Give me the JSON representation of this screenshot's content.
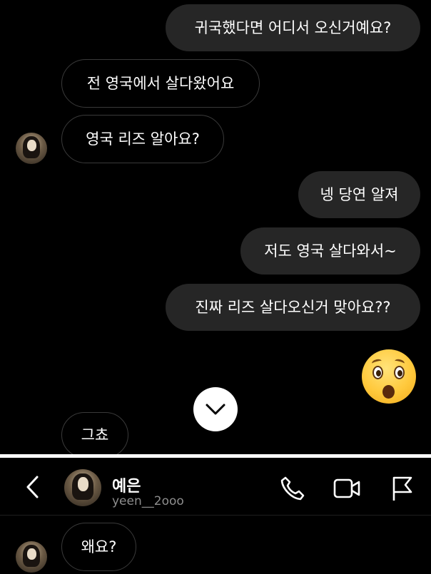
{
  "messages": [
    {
      "id": "m1",
      "side": "out",
      "text": "귀국했다면 어디서 오신거예요?"
    },
    {
      "id": "m2",
      "side": "in",
      "text": "전 영국에서 살다왔어요"
    },
    {
      "id": "m3",
      "side": "in",
      "text": "영국 리즈 알아요?"
    },
    {
      "id": "m4",
      "side": "out",
      "text": "넹 당연 알져"
    },
    {
      "id": "m5",
      "side": "out",
      "text": "저도 영국 살다와서~"
    },
    {
      "id": "m6",
      "side": "out",
      "text": "진짜 리즈 살다오신거 맞아요??"
    },
    {
      "id": "m7",
      "side": "out",
      "emoji": "astonished-face"
    },
    {
      "id": "m8",
      "side": "in",
      "text": "그쵸"
    },
    {
      "id": "m9",
      "side": "in",
      "text": "왜요?"
    }
  ],
  "header": {
    "display_name": "예은",
    "username": "yeen__2ooo",
    "back_icon": "chevron-left-icon",
    "call_icon": "phone-icon",
    "video_icon": "video-camera-icon",
    "report_icon": "flag-icon"
  },
  "scroll_button_icon": "chevron-down-icon",
  "colors": {
    "background": "#000000",
    "outgoing_bubble": "#262626",
    "incoming_border": "#3a3a3a",
    "text": "#ffffff",
    "secondary_text": "#8e8e8e"
  }
}
